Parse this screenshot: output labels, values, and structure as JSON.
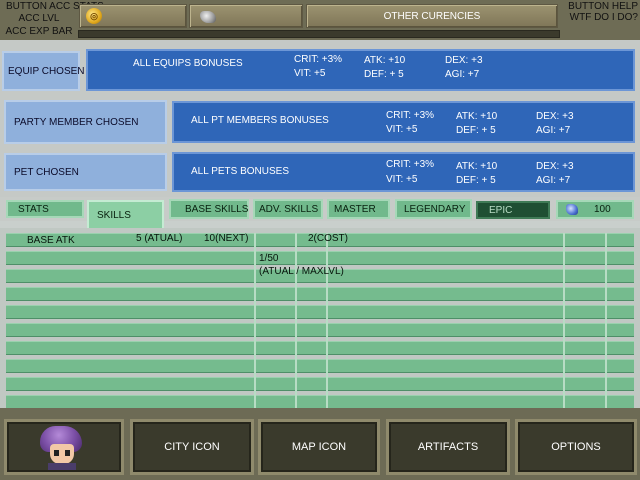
{
  "top": {
    "acc_stats_button": "BUTTON ACC STATS",
    "acc_lvl": "ACC LVL",
    "acc_exp_bar": "ACC EXP BAR",
    "other_currencies": "OTHER CURENCIES",
    "help_button": "BUTTON HELP WTF DO I DO?",
    "gold_icon": "gold-coin-icon",
    "gem_icon": "silver-ore-icon"
  },
  "bonus_rows": {
    "equip": {
      "chosen_label": "EQUIP CHOSEN",
      "bonus_title": "ALL EQUIPS BONUSES",
      "crit": "CRIT: +3%",
      "vit": "VIT: +5",
      "atk": "ATK: +10",
      "def": "DEF: + 5",
      "dex": "DEX: +3",
      "agi": "AGI: +7"
    },
    "party": {
      "chosen_label": "PARTY MEMBER CHOSEN",
      "bonus_title": "ALL PT MEMBERS BONUSES",
      "crit": "CRIT: +3%",
      "vit": "VIT: +5",
      "atk": "ATK: +10",
      "def": "DEF: + 5",
      "dex": "DEX: +3",
      "agi": "AGI: +7"
    },
    "pet": {
      "chosen_label": "PET CHOSEN",
      "bonus_title": "ALL PETS BONUSES",
      "crit": "CRIT: +3%",
      "vit": "VIT: +5",
      "atk": "ATK: +10",
      "def": "DEF: + 5",
      "dex": "DEX: +3",
      "agi": "AGI: +7"
    }
  },
  "tabs": {
    "stats": "STATS",
    "skills": "SKILLS",
    "base_skills": "BASE SKILLS",
    "adv_skills": "ADV. SKILLS",
    "master": "MASTER",
    "legendary": "LEGENDARY",
    "epic": "EPIC",
    "gem_icon": "blue-gem-icon",
    "points": "100"
  },
  "skill_row": {
    "name": "BASE ATK",
    "actual": "5 (ATUAL)",
    "next": "10(NEXT)",
    "cost": "2(COST)",
    "level": "1/50",
    "level_caption": "(ATUAL / MAXLVL)"
  },
  "bottom": {
    "avatar_icon": "purple-hair-character-portrait",
    "city": "CITY ICON",
    "map": "MAP ICON",
    "artifacts": "ARTIFACTS",
    "options": "OPTIONS"
  },
  "colors": {
    "panel_dark_blue": "#2f66b8",
    "panel_light_blue": "#8fb0dc",
    "tab_green": "#71b98c",
    "tab_dark_green": "#1f4f33",
    "frame_olive": "#6e6c55"
  }
}
